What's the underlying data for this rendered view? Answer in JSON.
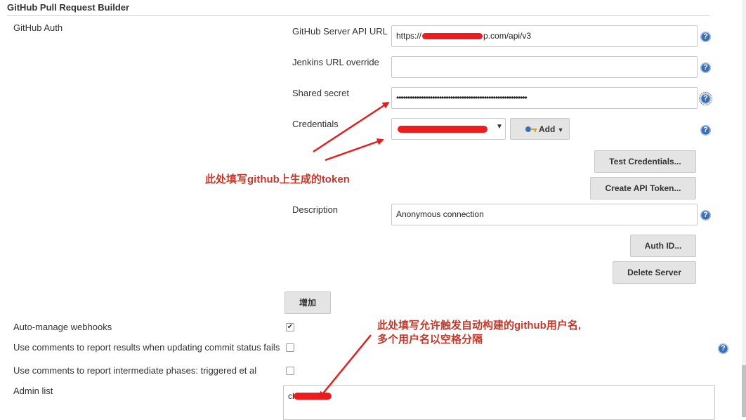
{
  "section": {
    "title": "GitHub Pull Request Builder"
  },
  "github_auth": {
    "label": "GitHub Auth",
    "server_api_url": {
      "label": "GitHub Server API URL",
      "prefix": "https://",
      "suffix": "p.com/api/v3"
    },
    "jenkins_url_override": {
      "label": "Jenkins URL override",
      "value": ""
    },
    "shared_secret": {
      "label": "Shared secret",
      "value": "••••••••••••••••••••••••••••••••••••••••••••••••••••••••••"
    },
    "credentials": {
      "label": "Credentials",
      "add_label": "Add"
    },
    "test_credentials_label": "Test Credentials...",
    "create_api_token_label": "Create API Token...",
    "description": {
      "label": "Description",
      "value": "Anonymous connection"
    },
    "auth_id_label": "Auth ID...",
    "delete_server_label": "Delete Server"
  },
  "add_server_label": "增加",
  "options": {
    "auto_manage_webhooks": {
      "label": "Auto-manage webhooks",
      "checked": true
    },
    "comments_commit_status": {
      "label": "Use comments to report results when updating commit status fails",
      "checked": false
    },
    "comments_intermediate": {
      "label": "Use comments to report intermediate phases: triggered et al",
      "checked": false
    }
  },
  "admin_list": {
    "label": "Admin list",
    "value": "ch"
  },
  "help_glyph": "?",
  "annotations": {
    "token_note": "此处填写github上生成的token",
    "admin_note_line1": "此处填写允许触发自动构建的github用户名,",
    "admin_note_line2": "多个用户名以空格分隔"
  },
  "colors": {
    "annotation": "#c0392b",
    "arrow": "#e02020",
    "help_icon": "#3a6fb5"
  }
}
